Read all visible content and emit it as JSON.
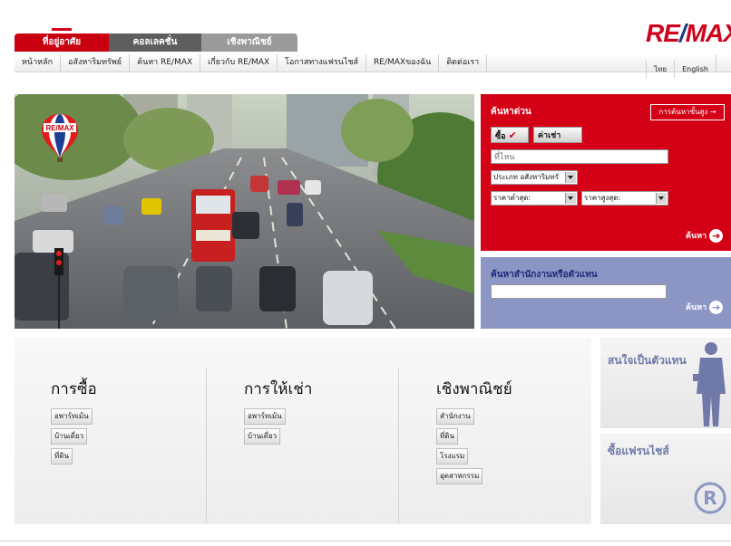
{
  "logo": {
    "text_red_left": "RE",
    "text_blue": "/",
    "text_red_right": "MAX"
  },
  "tabs": [
    {
      "label": "ที่อยู่อาศัย"
    },
    {
      "label": "คอลเลคชั่น"
    },
    {
      "label": "เชิงพาณิชย์"
    }
  ],
  "nav": [
    {
      "label": "หน้าหลัก"
    },
    {
      "label": "อสังหาริมทรัพย์"
    },
    {
      "label": "ค้นหา RE/MAX"
    },
    {
      "label": "เกี่ยวกับ RE/MAX"
    },
    {
      "label": "โอกาสทางแฟรนไชส์"
    },
    {
      "label": "RE/MAXของฉัน"
    },
    {
      "label": "ติดต่อเรา"
    }
  ],
  "languages": [
    {
      "label": "ไทย"
    },
    {
      "label": "English"
    }
  ],
  "search": {
    "title": "ค้นหาด่วน",
    "advanced": "การค้นหาขั้นสูง",
    "buy": "ซื้อ",
    "rent": "ค่าเช่า",
    "where_placeholder": "ที่ไหน",
    "property_type": "ประเภท อสังหาริมทรั",
    "min_price": "ราคาต่ำสุด:",
    "max_price": "ราคาสูงสุด:",
    "go": "ค้นหา"
  },
  "agent_search": {
    "title": "ค้นหาสำนักงานหรือตัวแทน",
    "go": "ค้นหา"
  },
  "columns": [
    {
      "title": "การซื้อ",
      "links": [
        "อพาร์ทเม้น",
        "บ้านเดี่ยว",
        "ที่ดิน"
      ]
    },
    {
      "title": "การให้เช่า",
      "links": [
        "อพาร์ทเม้น",
        "บ้านเดี่ยว"
      ]
    },
    {
      "title": "เชิงพาณิชย์",
      "links": [
        "สำนักงาน",
        "ที่ดิน",
        "โรงแรม",
        "อุตสาหกรรม"
      ]
    }
  ],
  "sidebar": {
    "agent": "สนใจเป็นตัวแทน",
    "franchise": "ซื้อแฟรนไชส์"
  },
  "colors": {
    "brand_red": "#d40016",
    "brand_blue": "#1b3a8a",
    "agent_panel": "#8b96c4"
  }
}
